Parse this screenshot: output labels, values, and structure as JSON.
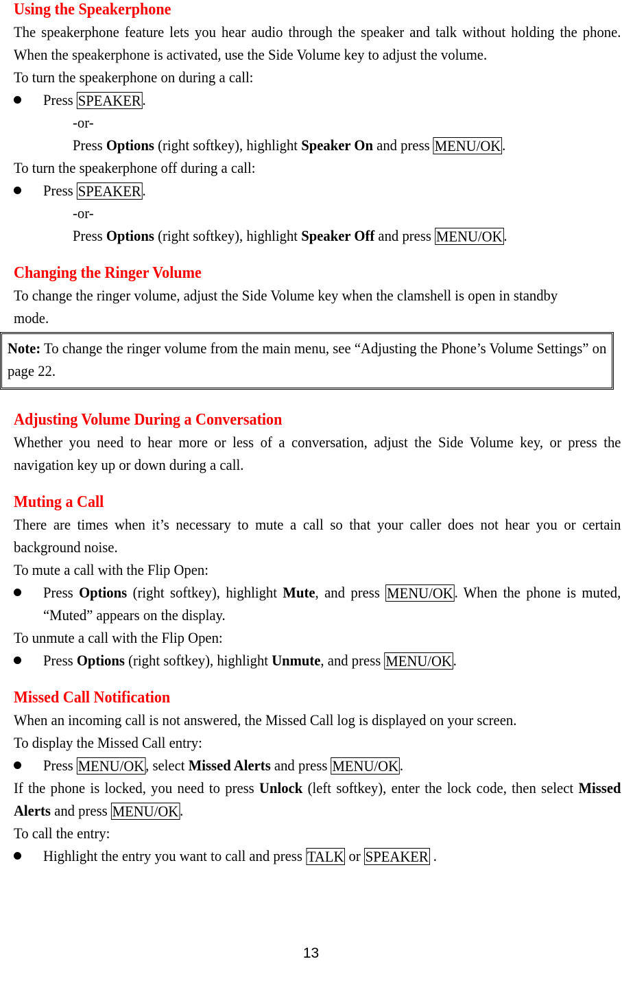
{
  "page": {
    "number": "13",
    "accent_color": "#ff0000",
    "text_color": "#000000",
    "background_color": "#ffffff"
  },
  "sections": {
    "speakerphone": {
      "heading": "Using the Speakerphone",
      "intro": "The speakerphone feature lets you hear audio through the speaker and talk without holding the phone. When the speakerphone is activated, use the Side Volume key to adjust the volume.",
      "lead_on": "To turn the speakerphone on during a call:",
      "bullet_on": {
        "press": "Press",
        "key": "SPEAKER",
        "period": "."
      },
      "or_label": "-or-",
      "alt_on": {
        "press": "Press",
        "options": "Options",
        "softkey": "(right softkey), highlight",
        "target": "Speaker On",
        "and_press": "and press",
        "key": "MENU/OK",
        "period": "."
      },
      "lead_off": "To turn the speakerphone off during a call:",
      "bullet_off": {
        "press": "Press",
        "key": "SPEAKER",
        "period": "."
      },
      "alt_off": {
        "press": "Press",
        "options": "Options",
        "softkey": "(right softkey), highlight",
        "target": "Speaker Off",
        "and_press": "and press",
        "key": "MENU/OK",
        "period": "."
      }
    },
    "ringer_volume": {
      "heading": "Changing the Ringer Volume",
      "body": "To change the ringer volume, adjust the Side Volume key when the clamshell is open in standby mode.",
      "note": {
        "label": "Note:",
        "text": "To change the ringer volume from the main menu, see “Adjusting the Phone’s Volume Settings” on page 22."
      }
    },
    "adjusting_volume": {
      "heading": "Adjusting Volume During a Conversation",
      "body": "Whether you need to hear more or less of a conversation, adjust the Side Volume key, or press the navigation key up or down during a call."
    },
    "muting": {
      "heading": "Muting a Call",
      "intro": "There are times when it’s necessary to mute a call so that your caller does not hear you or certain background noise.",
      "lead_mute": "To mute a call with the Flip Open:",
      "bullet_mute": {
        "press": "Press",
        "options": "Options",
        "softkey": "(right softkey), highlight",
        "target": "Mute",
        "and_press": ", and press",
        "key": "MENU/OK",
        "tail": ". When the phone is muted, “Muted” appears on the display."
      },
      "lead_unmute": "To unmute a call with the Flip Open:",
      "bullet_unmute": {
        "press": "Press",
        "options": "Options",
        "softkey": "(right softkey), highlight",
        "target": "Unmute",
        "and_press": ", and press",
        "key": "MENU/OK",
        "period": "."
      }
    },
    "missed_call": {
      "heading": "Missed Call Notification",
      "intro": "When an incoming call is not answered, the Missed Call log is displayed on your screen.",
      "lead_display": "To display the Missed Call entry:",
      "bullet_display": {
        "press": "Press",
        "key1": "MENU/OK",
        "select": ", select",
        "target": "Missed Alerts",
        "and_press": "and press",
        "key2": "MENU/OK",
        "period": "."
      },
      "locked_note": {
        "part1": "If the phone is locked, you need to press",
        "unlock": "Unlock",
        "part2": "(left softkey), enter the lock code, then select",
        "target": "Missed Alerts",
        "and_press": "and press",
        "key": "MENU/OK",
        "period": "."
      },
      "lead_call": "To call the entry:",
      "bullet_call": {
        "text": "Highlight the entry you want to call and press",
        "key1": "TALK",
        "or": "or",
        "key2": "SPEAKER",
        "period": "."
      }
    }
  }
}
